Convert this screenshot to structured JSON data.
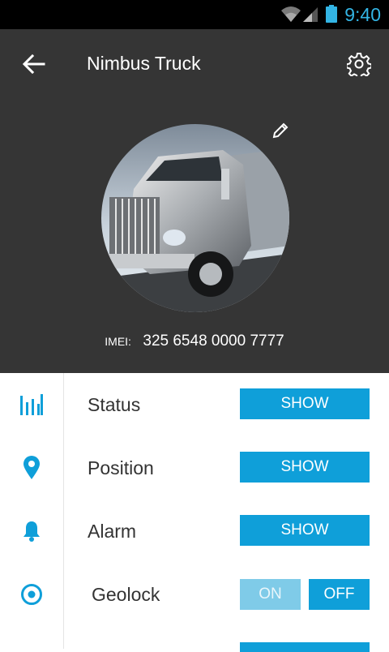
{
  "statusbar": {
    "time": "9:40"
  },
  "header": {
    "title": "Nimbus Truck",
    "imei_label": "IMEI:",
    "imei_value": "325 6548 0000 7777"
  },
  "rows": [
    {
      "label": "Status",
      "button": "SHOW",
      "icon": "bar-chart-icon"
    },
    {
      "label": "Position",
      "button": "SHOW",
      "icon": "location-pin-icon"
    },
    {
      "label": "Alarm",
      "button": "SHOW",
      "icon": "bell-icon"
    },
    {
      "label": "Geolock",
      "on_label": "ON",
      "off_label": "OFF",
      "selected": "OFF",
      "icon": "target-icon"
    }
  ],
  "colors": {
    "accent": "#0f9fd9",
    "accent_light": "#7fcbe8",
    "header_bg": "#353535",
    "status_time": "#33b5e5"
  }
}
